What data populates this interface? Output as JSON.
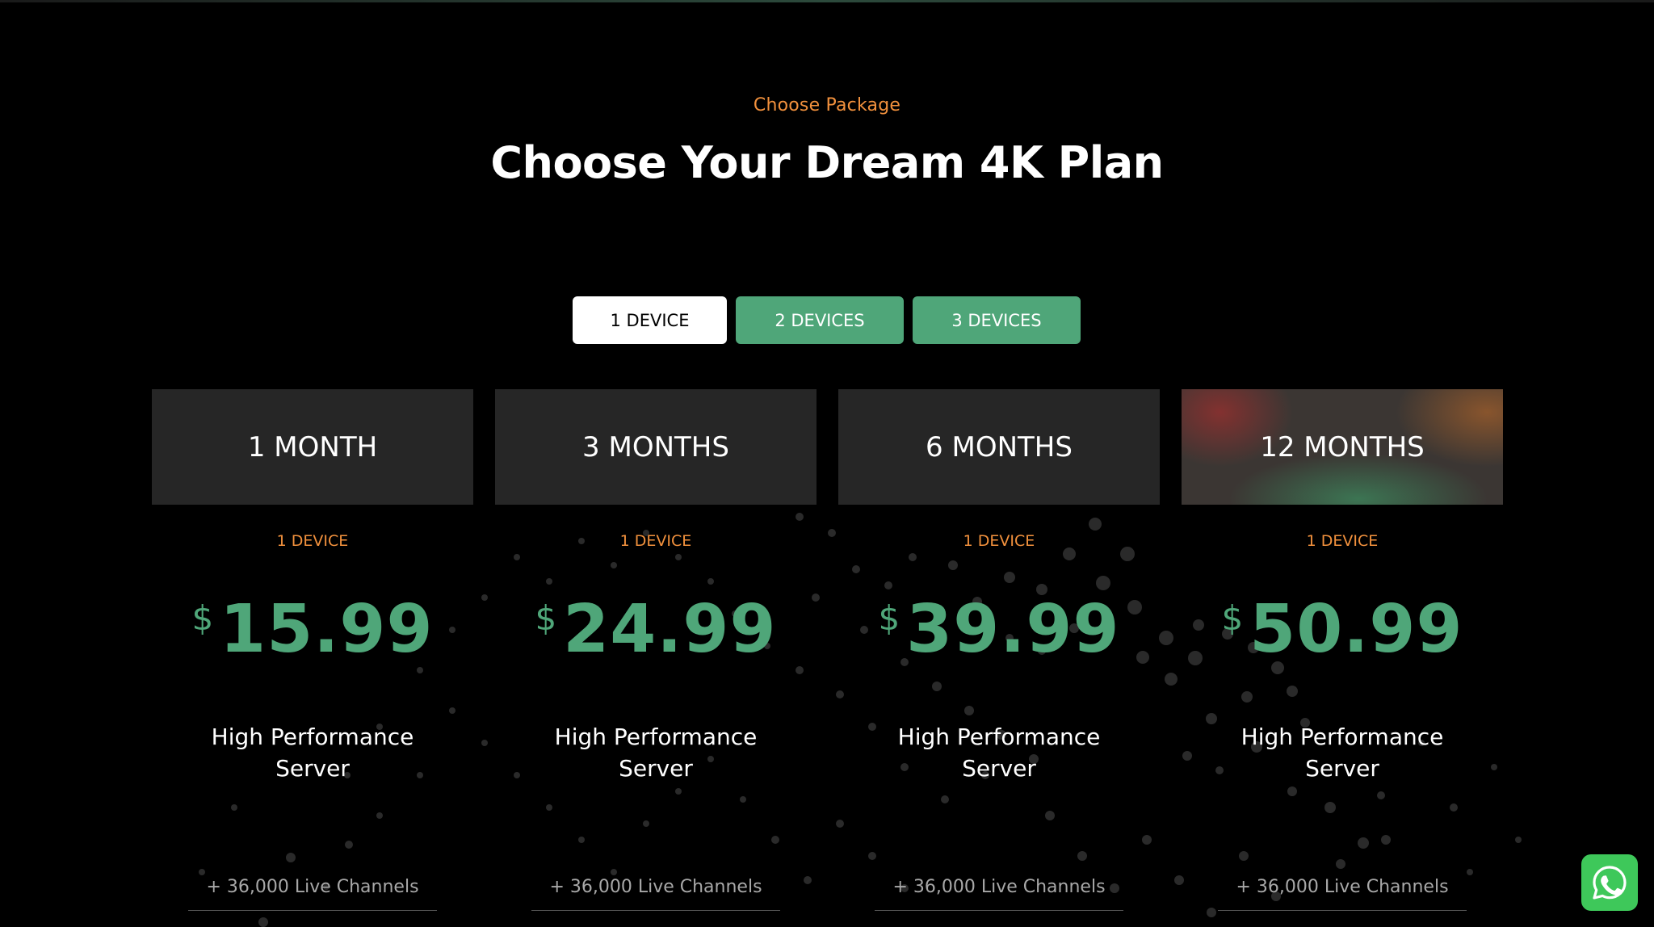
{
  "section": {
    "eyebrow": "Choose Package",
    "title": "Choose Your Dream 4K Plan"
  },
  "tabs": [
    {
      "label": "1 DEVICE",
      "active": true
    },
    {
      "label": "2 DEVICES",
      "active": false
    },
    {
      "label": "3 DEVICES",
      "active": false
    }
  ],
  "plans": [
    {
      "duration": "1 MONTH",
      "devices": "1 DEVICE",
      "currency": "$",
      "price": "15.99",
      "feature_line1": "High Performance",
      "feature_line2": "Server",
      "channels": "+ 36,000 Live Channels"
    },
    {
      "duration": "3 MONTHS",
      "devices": "1 DEVICE",
      "currency": "$",
      "price": "24.99",
      "feature_line1": "High Performance",
      "feature_line2": "Server",
      "channels": "+ 36,000 Live Channels"
    },
    {
      "duration": "6 MONTHS",
      "devices": "1 DEVICE",
      "currency": "$",
      "price": "39.99",
      "feature_line1": "High Performance",
      "feature_line2": "Server",
      "channels": "+ 36,000 Live Channels"
    },
    {
      "duration": "12 MONTHS",
      "devices": "1 DEVICE",
      "currency": "$",
      "price": "50.99",
      "feature_line1": "High Performance",
      "feature_line2": "Server",
      "channels": "+ 36,000 Live Channels"
    }
  ],
  "colors": {
    "accent_green": "#4fa679",
    "accent_orange": "#f2913d",
    "whatsapp_green": "#3ec85a"
  },
  "icons": {
    "floating_contact": "whatsapp-icon"
  }
}
